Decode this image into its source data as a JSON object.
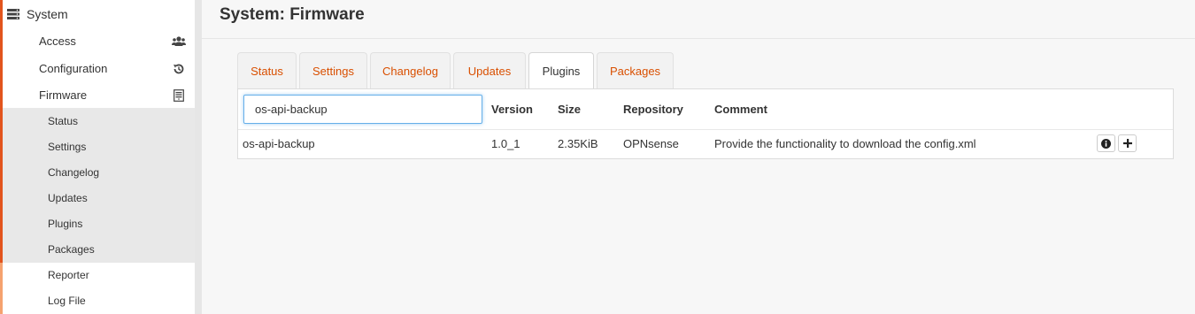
{
  "sidebar": {
    "system_label": "System",
    "items": [
      {
        "label": "Access",
        "icon": "users-icon"
      },
      {
        "label": "Configuration",
        "icon": "history-icon"
      },
      {
        "label": "Firmware",
        "icon": "server-icon"
      }
    ],
    "firmware_sub": [
      {
        "label": "Status"
      },
      {
        "label": "Settings"
      },
      {
        "label": "Changelog"
      },
      {
        "label": "Updates"
      },
      {
        "label": "Plugins"
      },
      {
        "label": "Packages"
      },
      {
        "label": "Reporter"
      },
      {
        "label": "Log File"
      }
    ]
  },
  "header": {
    "title": "System: Firmware"
  },
  "tabs": [
    {
      "label": "Status"
    },
    {
      "label": "Settings"
    },
    {
      "label": "Changelog"
    },
    {
      "label": "Updates"
    },
    {
      "label": "Plugins",
      "active": true
    },
    {
      "label": "Packages"
    }
  ],
  "table": {
    "search_value": "os-api-backup",
    "columns": [
      "Version",
      "Size",
      "Repository",
      "Comment"
    ],
    "rows": [
      {
        "name": "os-api-backup",
        "version": "1.0_1",
        "size": "2.35KiB",
        "repository": "OPNsense",
        "comment": "Provide the functionality to download the config.xml"
      }
    ]
  },
  "colors": {
    "accent": "#e2541d",
    "tab_link": "#d94f00"
  }
}
